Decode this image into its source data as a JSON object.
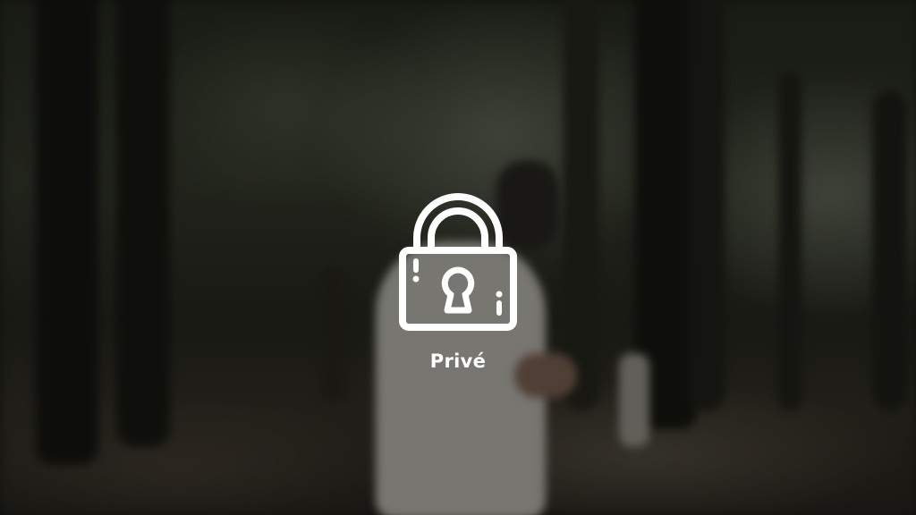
{
  "locked_media": {
    "label": "Privé",
    "icon": "padlock-icon"
  }
}
